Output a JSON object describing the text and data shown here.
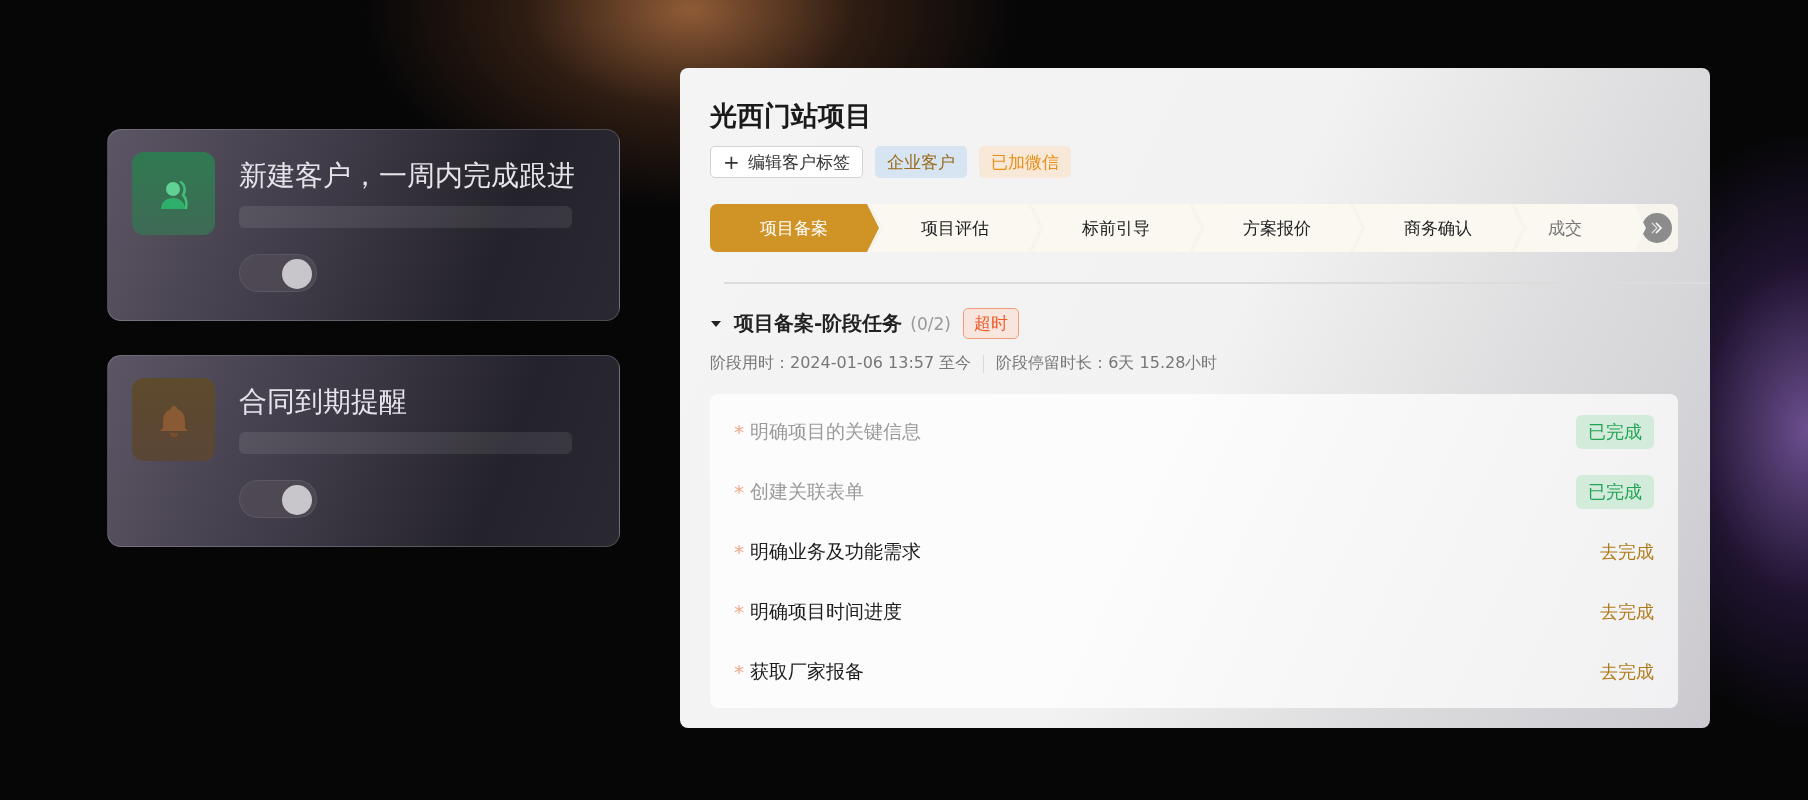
{
  "reminders": [
    {
      "kind": "customer",
      "title": "新建客户，一周内完成跟进",
      "on": true
    },
    {
      "kind": "bell",
      "title": "合同到期提醒",
      "on": true
    }
  ],
  "project": {
    "title": "光西门站项目",
    "tags": [
      {
        "kind": "add",
        "icon": "+",
        "label": "编辑客户标签"
      },
      {
        "kind": "blue",
        "label": "企业客户"
      },
      {
        "kind": "orange",
        "label": "已加微信"
      }
    ],
    "stages": [
      {
        "label": "项目备案",
        "selected": true
      },
      {
        "label": "项目评估",
        "selected": false
      },
      {
        "label": "标前引导",
        "selected": false
      },
      {
        "label": "方案报价",
        "selected": false
      },
      {
        "label": "商务确认",
        "selected": false
      },
      {
        "label": "成交",
        "selected": false
      }
    ],
    "section": {
      "expanded": true,
      "title": "项目备案-阶段任务",
      "count": "(0/2)",
      "badge": "超时",
      "time_used": "阶段用时：2024-01-06 13:57 至今",
      "stay": "阶段停留时长：6天 15.28小时"
    },
    "tasks": [
      {
        "mark": "*",
        "label": "明确项目的关键信息",
        "done": true,
        "status": "已完成"
      },
      {
        "mark": "*",
        "label": "创建关联表单",
        "done": true,
        "status": "已完成"
      },
      {
        "mark": "*",
        "label": "明确业务及功能需求",
        "done": false,
        "status": "去完成"
      },
      {
        "mark": "*",
        "label": "明确项目时间进度",
        "done": false,
        "status": "去完成"
      },
      {
        "mark": "*",
        "label": "获取厂家报备",
        "done": false,
        "status": "去完成"
      }
    ]
  }
}
